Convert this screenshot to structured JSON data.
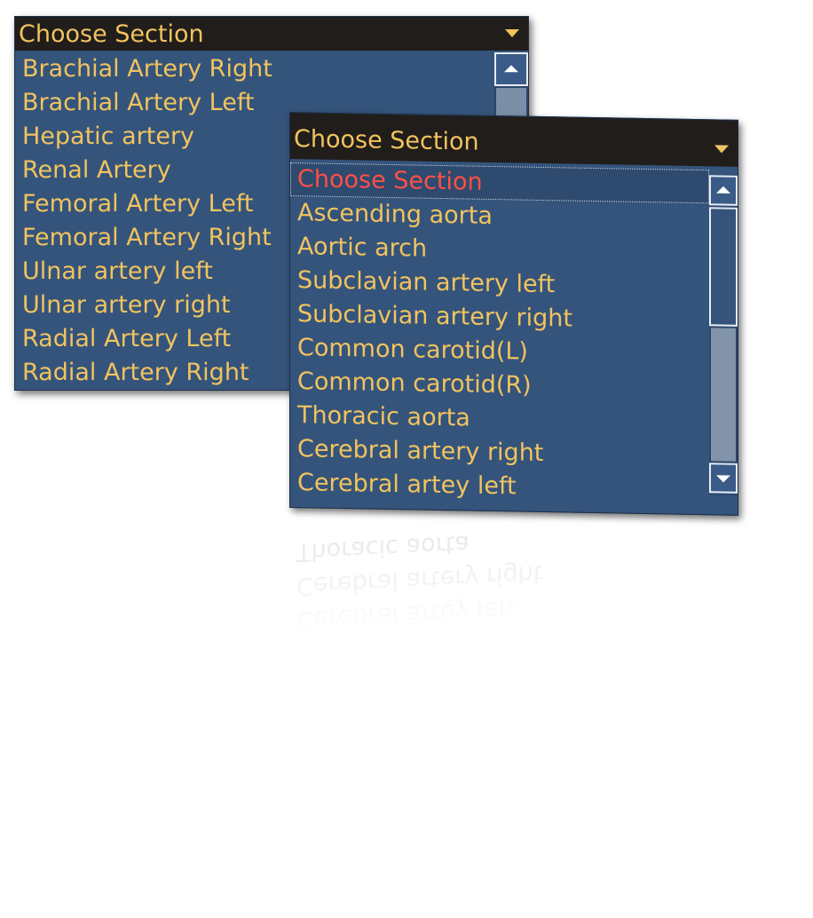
{
  "back_dropdown": {
    "header": "Choose Section",
    "items": [
      "Brachial Artery Right",
      "Brachial Artery Left",
      "Hepatic artery",
      "Renal Artery",
      "Femoral Artery Left",
      "Femoral Artery Right",
      "Ulnar artery left",
      "Ulnar artery right",
      "Radial Artery Left",
      "Radial Artery Right"
    ]
  },
  "front_dropdown": {
    "header": "Choose Section",
    "items": [
      "Choose Section",
      "Ascending aorta",
      "Aortic arch",
      "Subclavian artery left",
      "Subclavian artery right",
      "Common carotid(L)",
      "Common carotid(R)",
      "Thoracic aorta",
      "Cerebral artery right",
      "Cerebral artey left"
    ],
    "selected_index": 0
  },
  "colors": {
    "header_bg": "#201d1b",
    "list_bg": "#34547c",
    "item_text": "#f2c35e",
    "selected_text": "#ff5046"
  },
  "icons": [
    "chevron-down-icon",
    "scroll-up-icon",
    "scroll-down-icon"
  ]
}
